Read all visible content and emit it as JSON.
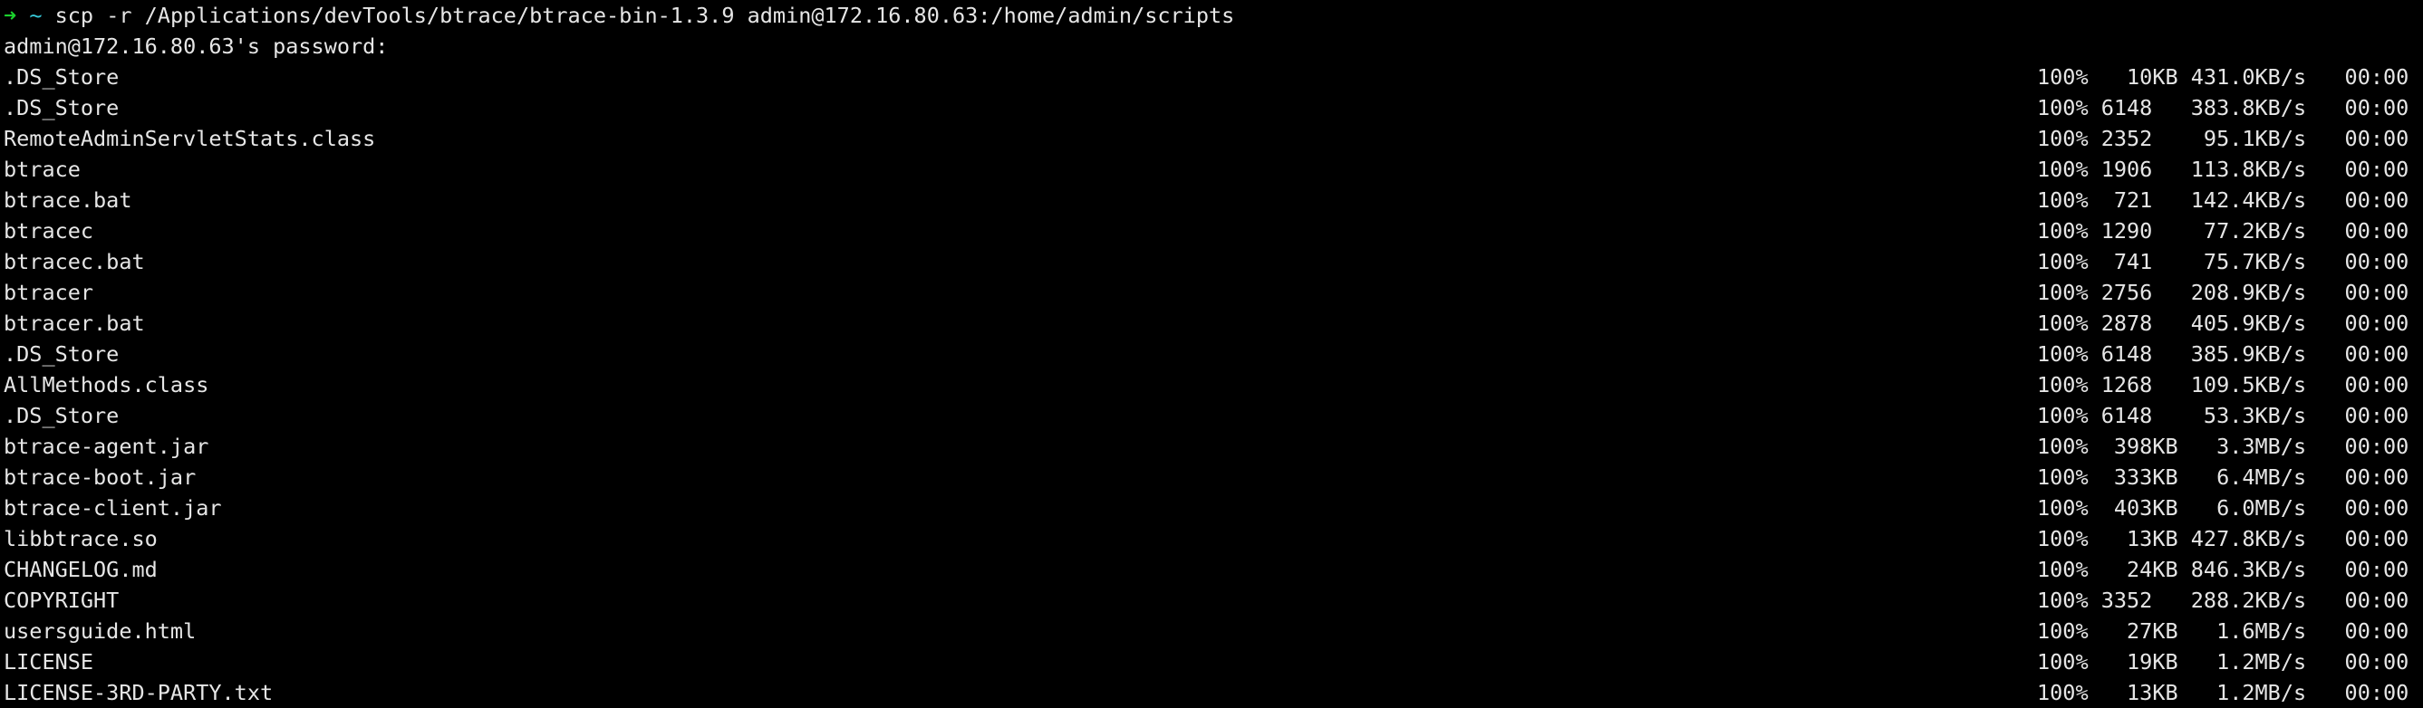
{
  "terminal": {
    "prompt_arrow": "➜",
    "prompt_dir": "~",
    "command": "scp -r /Applications/devTools/btrace/btrace-bin-1.3.9 admin@172.16.80.63:/home/admin/scripts",
    "password_prompt": "admin@172.16.80.63's password:",
    "colors": {
      "background": "#000000",
      "text": "#e6e6e6",
      "prompt_arrow": "#1bd12d",
      "prompt_dir": "#37c9d8"
    }
  },
  "transfers": [
    {
      "file": ".DS_Store",
      "stats": "100%   10KB 431.0KB/s   00:00"
    },
    {
      "file": ".DS_Store",
      "stats": "100% 6148   383.8KB/s   00:00"
    },
    {
      "file": "RemoteAdminServletStats.class",
      "stats": "100% 2352    95.1KB/s   00:00"
    },
    {
      "file": "btrace",
      "stats": "100% 1906   113.8KB/s   00:00"
    },
    {
      "file": "btrace.bat",
      "stats": "100%  721   142.4KB/s   00:00"
    },
    {
      "file": "btracec",
      "stats": "100% 1290    77.2KB/s   00:00"
    },
    {
      "file": "btracec.bat",
      "stats": "100%  741    75.7KB/s   00:00"
    },
    {
      "file": "btracer",
      "stats": "100% 2756   208.9KB/s   00:00"
    },
    {
      "file": "btracer.bat",
      "stats": "100% 2878   405.9KB/s   00:00"
    },
    {
      "file": ".DS_Store",
      "stats": "100% 6148   385.9KB/s   00:00"
    },
    {
      "file": "AllMethods.class",
      "stats": "100% 1268   109.5KB/s   00:00"
    },
    {
      "file": ".DS_Store",
      "stats": "100% 6148    53.3KB/s   00:00"
    },
    {
      "file": "btrace-agent.jar",
      "stats": "100%  398KB   3.3MB/s   00:00"
    },
    {
      "file": "btrace-boot.jar",
      "stats": "100%  333KB   6.4MB/s   00:00"
    },
    {
      "file": "btrace-client.jar",
      "stats": "100%  403KB   6.0MB/s   00:00"
    },
    {
      "file": "libbtrace.so",
      "stats": "100%   13KB 427.8KB/s   00:00"
    },
    {
      "file": "CHANGELOG.md",
      "stats": "100%   24KB 846.3KB/s   00:00"
    },
    {
      "file": "COPYRIGHT",
      "stats": "100% 3352   288.2KB/s   00:00"
    },
    {
      "file": "usersguide.html",
      "stats": "100%   27KB   1.6MB/s   00:00"
    },
    {
      "file": "LICENSE",
      "stats": "100%   19KB   1.2MB/s   00:00"
    },
    {
      "file": "LICENSE-3RD-PARTY.txt",
      "stats": "100%   13KB   1.2MB/s   00:00"
    }
  ]
}
